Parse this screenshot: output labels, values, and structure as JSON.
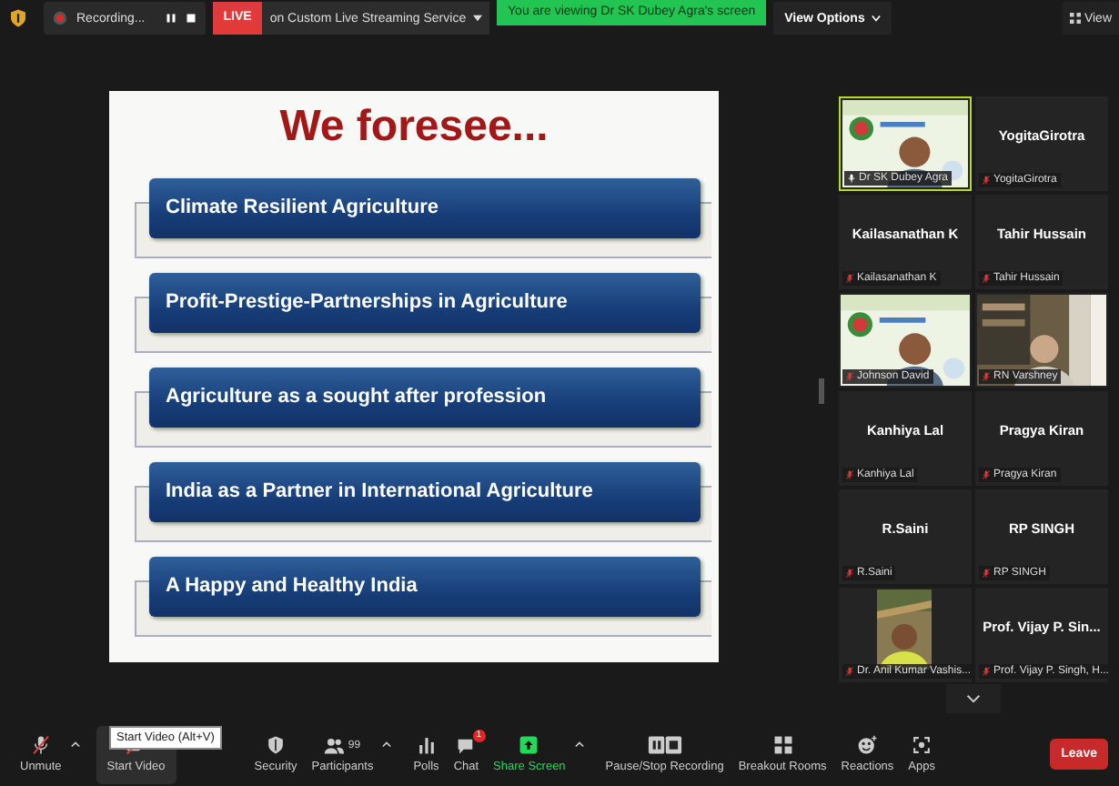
{
  "top_bar": {
    "recording": "Recording...",
    "live_badge": "LIVE",
    "live_service": "on Custom Live Streaming Service",
    "viewing_banner": "You are viewing Dr SK Dubey Agra's screen",
    "view_options": "View Options",
    "view": "View"
  },
  "slide": {
    "title": "We foresee...",
    "items": [
      "Climate Resilient Agriculture",
      "Profit-Prestige-Partnerships in Agriculture",
      "Agriculture as a sought after profession",
      "India as a Partner in International Agriculture",
      "A Happy and Healthy India"
    ]
  },
  "gallery": {
    "tiles": [
      {
        "kind": "video",
        "label": "Dr SK Dubey Agra",
        "muted": false,
        "active": true
      },
      {
        "kind": "name",
        "name": "YogitaGirotra",
        "label": "YogitaGirotra",
        "muted": true,
        "active": false
      },
      {
        "kind": "name",
        "name": "Kailasanathan K",
        "label": "Kailasanathan K",
        "muted": true,
        "active": false
      },
      {
        "kind": "name",
        "name": "Tahir Hussain",
        "label": "Tahir Hussain",
        "muted": true,
        "active": false
      },
      {
        "kind": "video",
        "label": "Johnson David",
        "muted": true,
        "active": false
      },
      {
        "kind": "video",
        "label": "RN Varshney",
        "muted": true,
        "active": false
      },
      {
        "kind": "name",
        "name": "Kanhiya Lal",
        "label": "Kanhiya Lal",
        "muted": true,
        "active": false
      },
      {
        "kind": "name",
        "name": "Pragya Kiran",
        "label": "Pragya Kiran",
        "muted": true,
        "active": false
      },
      {
        "kind": "name",
        "name": "R.Saini",
        "label": "R.Saini",
        "muted": true,
        "active": false
      },
      {
        "kind": "name",
        "name": "RP SINGH",
        "label": "RP SINGH",
        "muted": true,
        "active": false
      },
      {
        "label": "Dr. Anil Kumar Vashis...",
        "muted": true,
        "active": false
      },
      {
        "kind": "name",
        "name": "Prof. Vijay P. Sin...",
        "label": "Prof. Vijay P. Singh, H...",
        "muted": true,
        "active": false
      }
    ]
  },
  "toolbar": {
    "buttons": [
      {
        "kind": "mic",
        "label": "Unmute",
        "caret": true,
        "hovered": false
      },
      {
        "kind": "video",
        "label": "Start Video",
        "caret": false,
        "hovered": true
      },
      {
        "kind": "security",
        "label": "Security",
        "caret": false,
        "hovered": false
      },
      {
        "kind": "participants",
        "label": "Participants",
        "count": "99",
        "caret": true,
        "hovered": false
      },
      {
        "kind": "polls",
        "label": "Polls",
        "caret": false,
        "hovered": false
      },
      {
        "kind": "chat",
        "label": "Chat",
        "badge": "1",
        "caret": false,
        "hovered": false
      },
      {
        "kind": "share",
        "label": "Share Screen",
        "caret": true,
        "hovered": false
      },
      {
        "kind": "record",
        "label": "Pause/Stop Recording",
        "caret": false,
        "hovered": false
      },
      {
        "kind": "breakout",
        "label": "Breakout Rooms",
        "caret": false,
        "hovered": false
      },
      {
        "kind": "reactions",
        "label": "Reactions",
        "caret": false,
        "hovered": false
      },
      {
        "kind": "apps",
        "label": "Apps",
        "caret": false,
        "hovered": false
      }
    ],
    "leave": "Leave",
    "tooltip": "Start Video (Alt+V)"
  }
}
